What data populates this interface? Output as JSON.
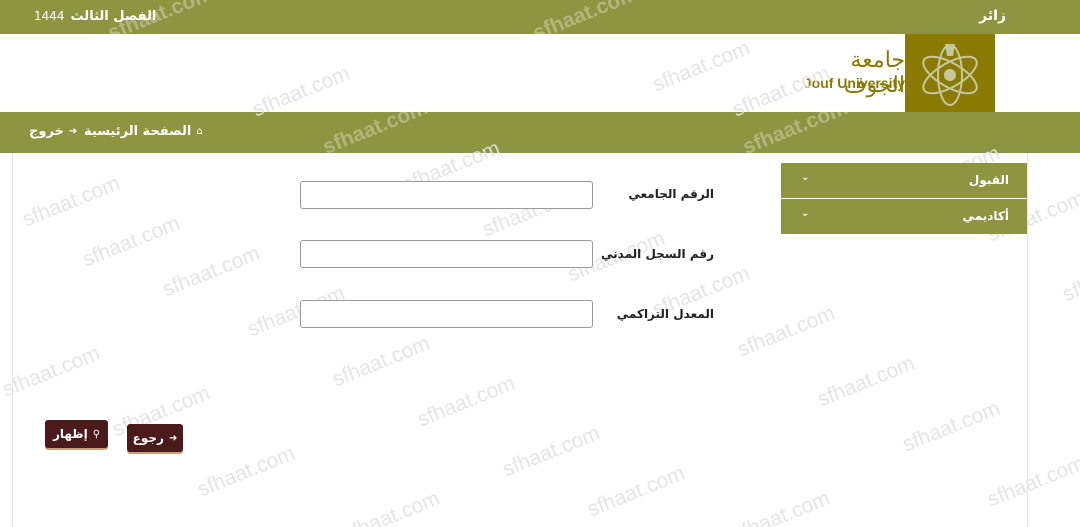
{
  "topbar": {
    "term_label": "الفصل الثالث",
    "term_year": "1444",
    "user_label": "زائر"
  },
  "header": {
    "logo_arabic": "جامعة الجوف",
    "logo_english": "Jouf University"
  },
  "nav": {
    "home_label": "الصفحة الرئيسية",
    "logout_label": "خروج"
  },
  "sidebar": {
    "items": [
      {
        "label": "القبول"
      },
      {
        "label": "أكاديمي"
      }
    ]
  },
  "form": {
    "fields": [
      {
        "label": "الرقم الجامعي",
        "value": ""
      },
      {
        "label": "رقم السجل المدني",
        "value": ""
      },
      {
        "label": "المعدل التراكمي",
        "value": ""
      }
    ]
  },
  "buttons": {
    "show_label": "إظهار",
    "back_label": "رجوع"
  },
  "watermark": {
    "text": "sfhaat.com"
  },
  "colors": {
    "bar": "#8f9440",
    "logo": "#8a7b00",
    "button": "#4b1a1a"
  }
}
